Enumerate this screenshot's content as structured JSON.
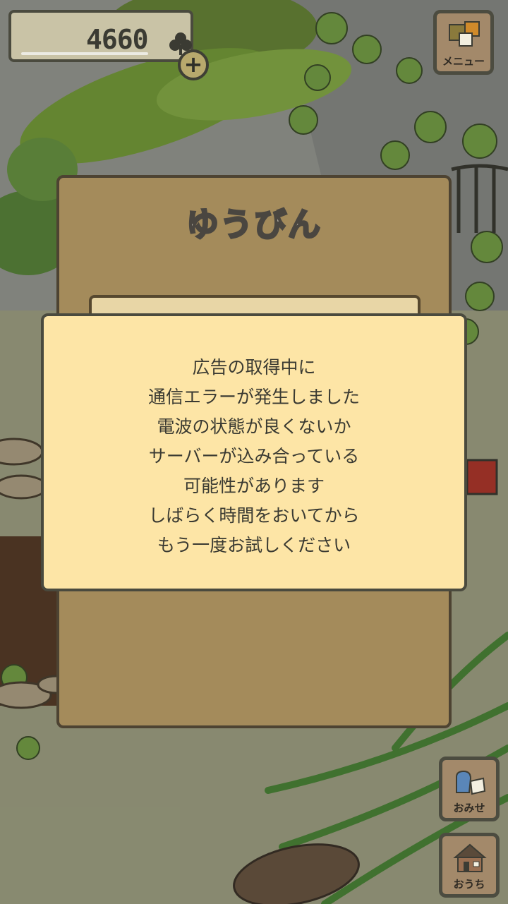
{
  "currency": {
    "amount": "4660",
    "icon": "clover-icon",
    "add_icon": "plus-icon"
  },
  "menu_button": {
    "label": "メニュー"
  },
  "shop_button": {
    "label": "おみせ"
  },
  "home_button": {
    "label": "おうち"
  },
  "post_panel": {
    "title": "ゆうびん"
  },
  "error_dialog": {
    "lines": [
      "広告の取得中に",
      "通信エラーが発生しました",
      "電波の状態が良くないか",
      "サーバーが込み合っている",
      "可能性があります",
      "しばらく時間をおいてから",
      "もう一度お試しください"
    ]
  },
  "colors": {
    "panel": "#a48b5b",
    "dialog": "#fde5a6",
    "outline": "#4a4a3e",
    "text": "#3a3a32"
  }
}
